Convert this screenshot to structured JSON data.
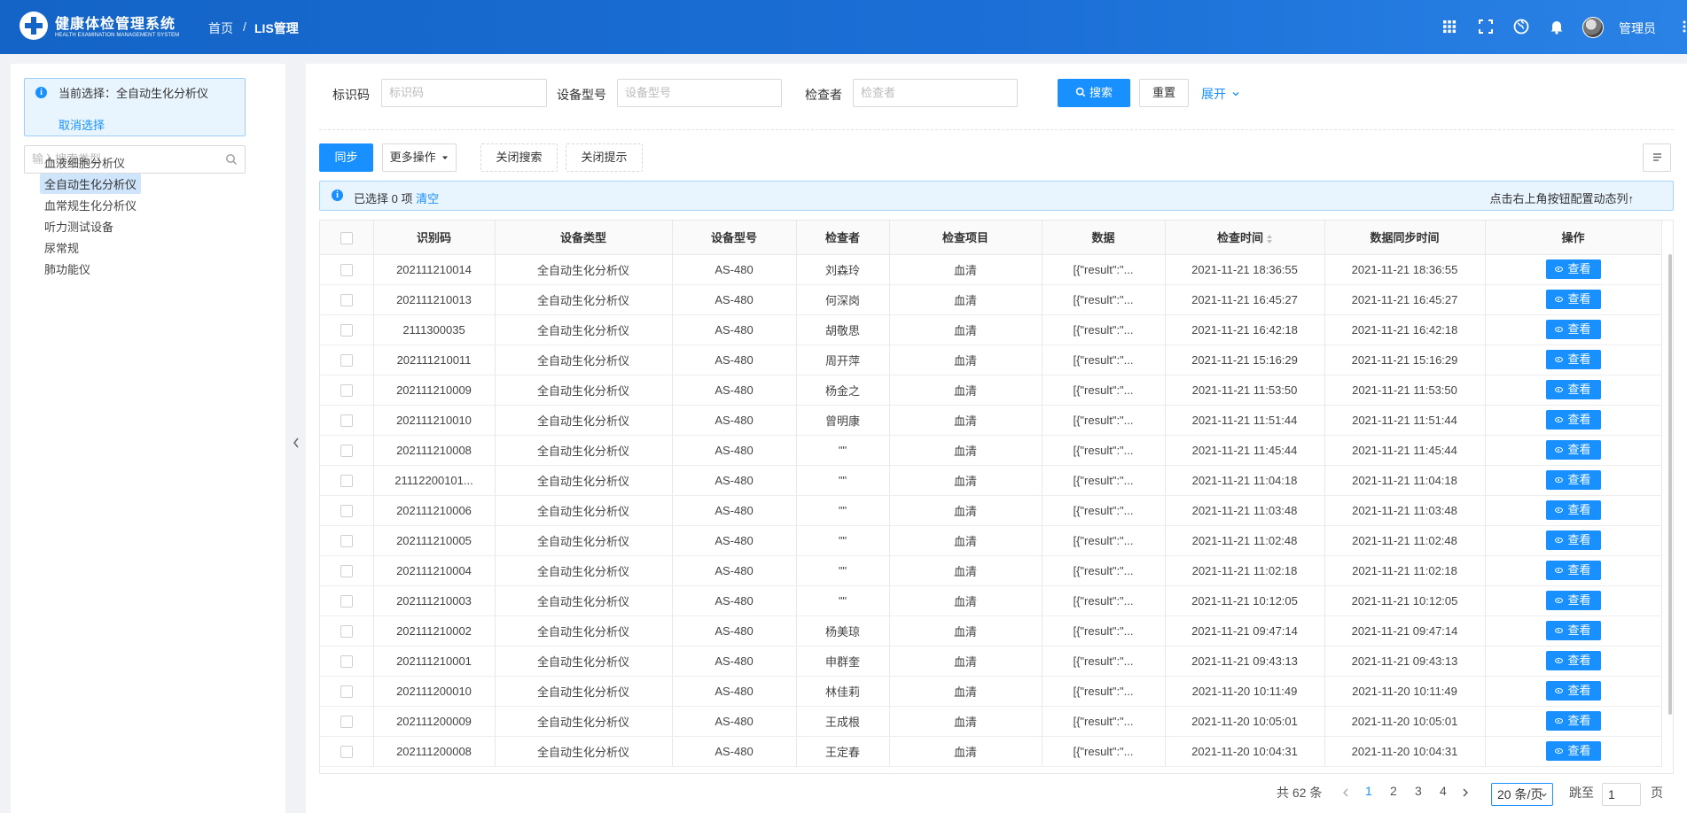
{
  "header": {
    "brand_cn": "健康体检管理系统",
    "brand_en": "HEALTH EXAMINATION MANAGEMENT SYSTEM",
    "breadcrumb_home": "首页",
    "breadcrumb_sep": "/",
    "breadcrumb_current": "LIS管理",
    "user_name": "管理员",
    "icons": [
      "grid-icon",
      "fullscreen-icon",
      "globe-icon",
      "bell-icon"
    ]
  },
  "left": {
    "current_label": "当前选择：",
    "current_value": "全自动生化分析仪",
    "cancel_label": "取消选择",
    "search_placeholder": "输入搜索类型",
    "tree_items": [
      "血液细胞分析仪",
      "全自动生化分析仪",
      "血常规生化分析仪",
      "听力测试设备",
      "尿常规",
      "肺功能仪"
    ],
    "active_index": 1
  },
  "search": {
    "id_label": "标识码",
    "id_placeholder": "标识码",
    "model_label": "设备型号",
    "model_placeholder": "设备型号",
    "checker_label": "检查者",
    "checker_placeholder": "检查者",
    "search_btn": "搜索",
    "reset_btn": "重置",
    "expand_link": "展开"
  },
  "toolbar": {
    "sync_btn": "同步",
    "more_btn": "更多操作",
    "close_search_btn": "关闭搜索",
    "close_tip_btn": "关闭提示"
  },
  "alert": {
    "selected_prefix": "已选择",
    "selected_count": "0",
    "selected_unit": "项",
    "clear_link": "清空",
    "right_tip": "点击右上角按钮配置动态列↑"
  },
  "table": {
    "columns": [
      "识别码",
      "设备类型",
      "设备型号",
      "检查者",
      "检查项目",
      "数据",
      "检查时间",
      "数据同步时间",
      "操作"
    ],
    "view_label": "查看",
    "rows": [
      [
        "202111210014",
        "全自动生化分析仪",
        "AS-480",
        "刘森玲",
        "血清",
        "[{\"result\":\"...",
        "2021-11-21 18:36:55",
        "2021-11-21 18:36:55"
      ],
      [
        "202111210013",
        "全自动生化分析仪",
        "AS-480",
        "何深岗",
        "血清",
        "[{\"result\":\"...",
        "2021-11-21 16:45:27",
        "2021-11-21 16:45:27"
      ],
      [
        "2111300035",
        "全自动生化分析仪",
        "AS-480",
        "胡敬思",
        "血清",
        "[{\"result\":\"...",
        "2021-11-21 16:42:18",
        "2021-11-21 16:42:18"
      ],
      [
        "202111210011",
        "全自动生化分析仪",
        "AS-480",
        "周开萍",
        "血清",
        "[{\"result\":\"...",
        "2021-11-21 15:16:29",
        "2021-11-21 15:16:29"
      ],
      [
        "202111210009",
        "全自动生化分析仪",
        "AS-480",
        "杨金之",
        "血清",
        "[{\"result\":\"...",
        "2021-11-21 11:53:50",
        "2021-11-21 11:53:50"
      ],
      [
        "202111210010",
        "全自动生化分析仪",
        "AS-480",
        "曾明康",
        "血清",
        "[{\"result\":\"...",
        "2021-11-21 11:51:44",
        "2021-11-21 11:51:44"
      ],
      [
        "202111210008",
        "全自动生化分析仪",
        "AS-480",
        "\"\"",
        "血清",
        "[{\"result\":\"...",
        "2021-11-21 11:45:44",
        "2021-11-21 11:45:44"
      ],
      [
        "21112200101...",
        "全自动生化分析仪",
        "AS-480",
        "\"\"",
        "血清",
        "[{\"result\":\"...",
        "2021-11-21 11:04:18",
        "2021-11-21 11:04:18"
      ],
      [
        "202111210006",
        "全自动生化分析仪",
        "AS-480",
        "\"\"",
        "血清",
        "[{\"result\":\"...",
        "2021-11-21 11:03:48",
        "2021-11-21 11:03:48"
      ],
      [
        "202111210005",
        "全自动生化分析仪",
        "AS-480",
        "\"\"",
        "血清",
        "[{\"result\":\"...",
        "2021-11-21 11:02:48",
        "2021-11-21 11:02:48"
      ],
      [
        "202111210004",
        "全自动生化分析仪",
        "AS-480",
        "\"\"",
        "血清",
        "[{\"result\":\"...",
        "2021-11-21 11:02:18",
        "2021-11-21 11:02:18"
      ],
      [
        "202111210003",
        "全自动生化分析仪",
        "AS-480",
        "\"\"",
        "血清",
        "[{\"result\":\"...",
        "2021-11-21 10:12:05",
        "2021-11-21 10:12:05"
      ],
      [
        "202111210002",
        "全自动生化分析仪",
        "AS-480",
        "杨美琼",
        "血清",
        "[{\"result\":\"...",
        "2021-11-21 09:47:14",
        "2021-11-21 09:47:14"
      ],
      [
        "202111210001",
        "全自动生化分析仪",
        "AS-480",
        "申群奎",
        "血清",
        "[{\"result\":\"...",
        "2021-11-21 09:43:13",
        "2021-11-21 09:43:13"
      ],
      [
        "202111200010",
        "全自动生化分析仪",
        "AS-480",
        "林佳莉",
        "血清",
        "[{\"result\":\"...",
        "2021-11-20 10:11:49",
        "2021-11-20 10:11:49"
      ],
      [
        "202111200009",
        "全自动生化分析仪",
        "AS-480",
        "王成根",
        "血清",
        "[{\"result\":\"...",
        "2021-11-20 10:05:01",
        "2021-11-20 10:05:01"
      ],
      [
        "202111200008",
        "全自动生化分析仪",
        "AS-480",
        "王定春",
        "血清",
        "[{\"result\":\"...",
        "2021-11-20 10:04:31",
        "2021-11-20 10:04:31"
      ]
    ]
  },
  "pagination": {
    "total_text": "共 62 条",
    "pages": [
      "1",
      "2",
      "3",
      "4"
    ],
    "current_page": "1",
    "page_size": "20 条/页",
    "jump_label": "跳至",
    "jump_value": "1",
    "page_suffix": "页"
  },
  "colors": {
    "primary": "#1890ff",
    "header_bg": "#1464c7"
  }
}
